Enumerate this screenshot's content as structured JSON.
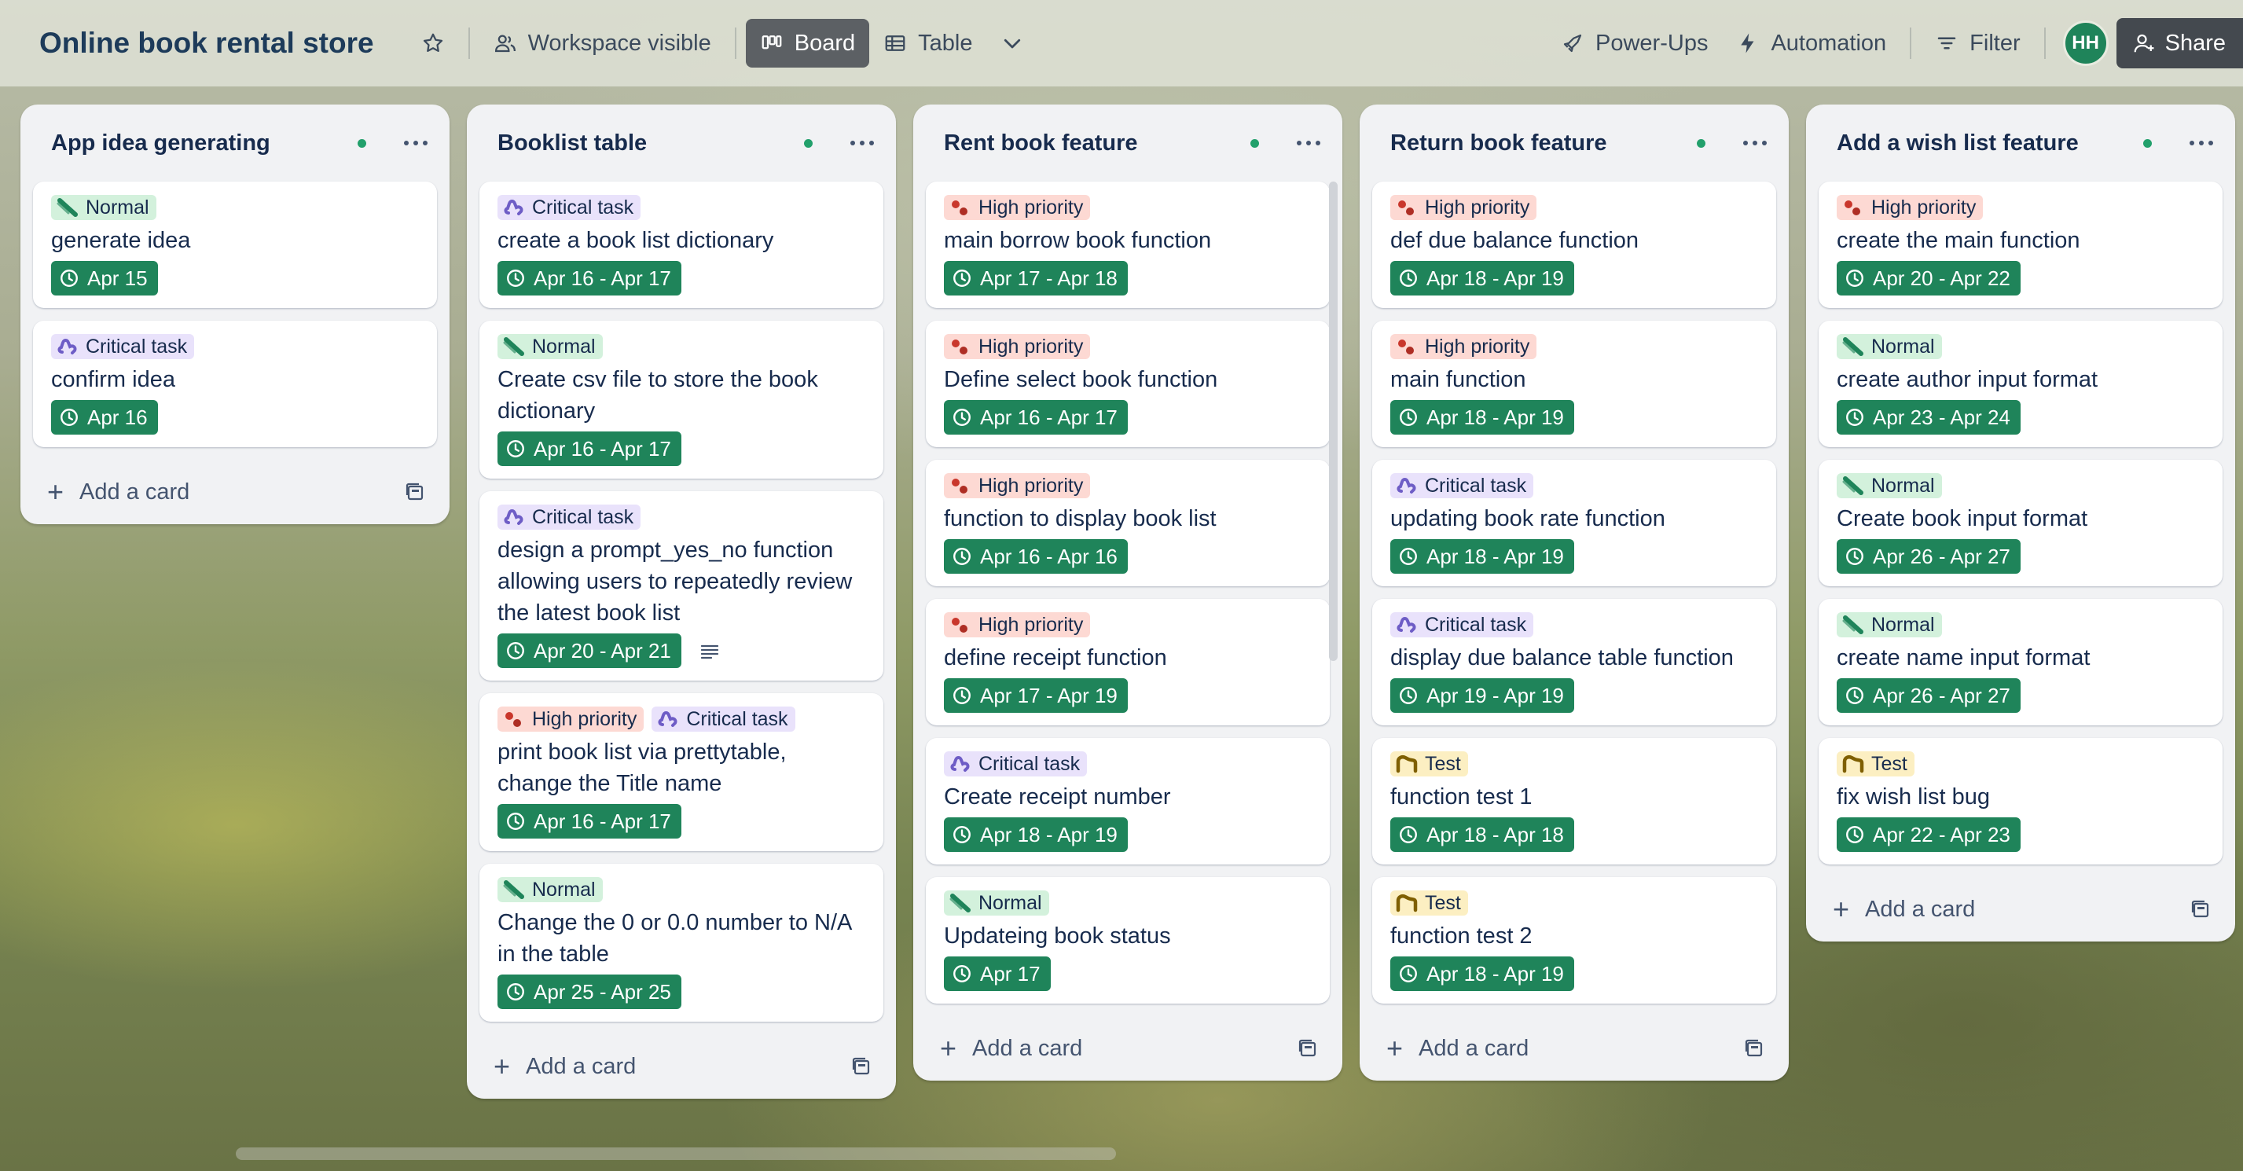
{
  "header": {
    "board_title": "Online book rental store",
    "workspace_visible": "Workspace visible",
    "board_view": "Board",
    "table_view": "Table",
    "power_ups": "Power-Ups",
    "automation": "Automation",
    "filter": "Filter",
    "avatar_initials": "HH",
    "share": "Share"
  },
  "colors": {
    "date_badge": "#1f845a",
    "normal_label": "#d3f1dc",
    "critical_label": "#e9e2fb",
    "high_label": "#fdd9d3",
    "test_label": "#fcefc2"
  },
  "icons": {
    "normal": "slash-icon",
    "critical": "puzzle-icon",
    "high": "dots-icon",
    "test": "bridge-icon",
    "date": "clock-icon",
    "description": "lines-icon",
    "template": "template-icon"
  },
  "lists": [
    {
      "title": "App idea generating",
      "add_card": "Add a card",
      "cards": [
        {
          "labels": [
            {
              "type": "normal",
              "text": "Normal"
            }
          ],
          "title": "generate idea",
          "date": "Apr 15"
        },
        {
          "labels": [
            {
              "type": "critical",
              "text": "Critical task"
            }
          ],
          "title": "confirm idea",
          "date": "Apr 16"
        }
      ]
    },
    {
      "title": "Booklist table",
      "add_card": "Add a card",
      "cards": [
        {
          "labels": [
            {
              "type": "critical",
              "text": "Critical task"
            }
          ],
          "title": "create a book list dictionary",
          "date": "Apr 16 - Apr 17"
        },
        {
          "labels": [
            {
              "type": "normal",
              "text": "Normal"
            }
          ],
          "title": "Create csv file to store the book dictionary",
          "date": "Apr 16 - Apr 17"
        },
        {
          "labels": [
            {
              "type": "critical",
              "text": "Critical task"
            }
          ],
          "title": "design a prompt_yes_no function allowing users to repeatedly review the latest book list",
          "date": "Apr 20 - Apr 21",
          "has_description": true
        },
        {
          "labels": [
            {
              "type": "high",
              "text": "High priority"
            },
            {
              "type": "critical",
              "text": "Critical task"
            }
          ],
          "title": "print book list via prettytable, change the Title name",
          "date": "Apr 16 - Apr 17"
        },
        {
          "labels": [
            {
              "type": "normal",
              "text": "Normal"
            }
          ],
          "title": "Change the 0 or 0.0 number to N/A in the table",
          "date": "Apr 25 - Apr 25"
        }
      ]
    },
    {
      "title": "Rent book feature",
      "add_card": "Add a card",
      "cards": [
        {
          "labels": [
            {
              "type": "high",
              "text": "High priority"
            }
          ],
          "title": "main borrow book function",
          "date": "Apr 17 - Apr 18"
        },
        {
          "labels": [
            {
              "type": "high",
              "text": "High priority"
            }
          ],
          "title": "Define select book function",
          "date": "Apr 16 - Apr 17"
        },
        {
          "labels": [
            {
              "type": "high",
              "text": "High priority"
            }
          ],
          "title": "function to display book list",
          "date": "Apr 16 - Apr 16"
        },
        {
          "labels": [
            {
              "type": "high",
              "text": "High priority"
            }
          ],
          "title": "define receipt function",
          "date": "Apr 17 - Apr 19"
        },
        {
          "labels": [
            {
              "type": "critical",
              "text": "Critical task"
            }
          ],
          "title": "Create receipt number",
          "date": "Apr 18 - Apr 19"
        },
        {
          "labels": [
            {
              "type": "normal",
              "text": "Normal"
            }
          ],
          "title": "Updateing book status",
          "date": "Apr 17"
        }
      ]
    },
    {
      "title": "Return book feature",
      "add_card": "Add a card",
      "cards": [
        {
          "labels": [
            {
              "type": "high",
              "text": "High priority"
            }
          ],
          "title": "def due balance function",
          "date": "Apr 18 - Apr 19"
        },
        {
          "labels": [
            {
              "type": "high",
              "text": "High priority"
            }
          ],
          "title": "main function",
          "date": "Apr 18 - Apr 19"
        },
        {
          "labels": [
            {
              "type": "critical",
              "text": "Critical task"
            }
          ],
          "title": "updating book rate function",
          "date": "Apr 18 - Apr 19"
        },
        {
          "labels": [
            {
              "type": "critical",
              "text": "Critical task"
            }
          ],
          "title": "display due balance table function",
          "date": "Apr 19 - Apr 19"
        },
        {
          "labels": [
            {
              "type": "test",
              "text": "Test"
            }
          ],
          "title": "function test 1",
          "date": "Apr 18 - Apr 18"
        },
        {
          "labels": [
            {
              "type": "test",
              "text": "Test"
            }
          ],
          "title": "function test 2",
          "date": "Apr 18 - Apr 19"
        }
      ]
    },
    {
      "title": "Add a wish list feature",
      "add_card": "Add a card",
      "cards": [
        {
          "labels": [
            {
              "type": "high",
              "text": "High priority"
            }
          ],
          "title": "create the main function",
          "date": "Apr 20 - Apr 22"
        },
        {
          "labels": [
            {
              "type": "normal",
              "text": "Normal"
            }
          ],
          "title": "create author input format",
          "date": "Apr 23 - Apr 24"
        },
        {
          "labels": [
            {
              "type": "normal",
              "text": "Normal"
            }
          ],
          "title": "Create book input format",
          "date": "Apr 26 - Apr 27"
        },
        {
          "labels": [
            {
              "type": "normal",
              "text": "Normal"
            }
          ],
          "title": "create name input format",
          "date": "Apr 26 - Apr 27"
        },
        {
          "labels": [
            {
              "type": "test",
              "text": "Test"
            }
          ],
          "title": "fix wish list bug",
          "date": "Apr 22 - Apr 23"
        }
      ]
    }
  ]
}
